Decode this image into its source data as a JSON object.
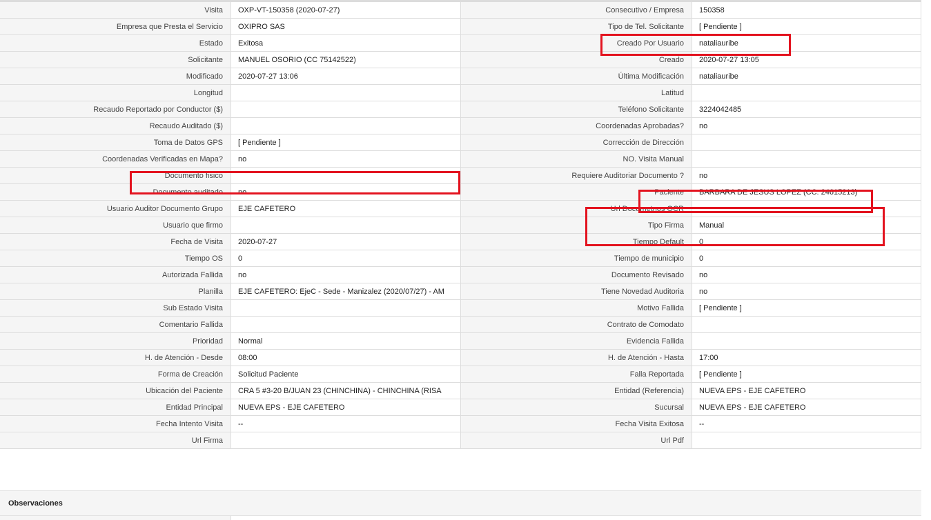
{
  "rows": [
    {
      "l1": "Visita",
      "v1": "OXP-VT-150358 (2020-07-27)",
      "l2": "Consecutivo / Empresa",
      "v2": "150358"
    },
    {
      "l1": "Empresa que Presta el Servicio",
      "v1": "OXIPRO SAS",
      "l2": "Tipo de Tel. Solicitante",
      "v2": "[ Pendiente ]"
    },
    {
      "l1": "Estado",
      "v1": "Exitosa",
      "l2": "Creado Por Usuario",
      "v2": "nataliauribe"
    },
    {
      "l1": "Solicitante",
      "v1": "MANUEL OSORIO (CC 75142522)",
      "l2": "Creado",
      "v2": "2020-07-27 13:05"
    },
    {
      "l1": "Modificado",
      "v1": "2020-07-27 13:06",
      "l2": "Última Modificación",
      "v2": " nataliauribe"
    },
    {
      "l1": "Longitud",
      "v1": "",
      "l2": "Latitud",
      "v2": ""
    },
    {
      "l1": "Recaudo Reportado por Conductor ($)",
      "v1": "",
      "l2": "Teléfono Solicitante",
      "v2": "3224042485"
    },
    {
      "l1": "Recaudo Auditado ($)",
      "v1": "",
      "l2": "Coordenadas Aprobadas?",
      "v2": " no"
    },
    {
      "l1": "Toma de Datos GPS",
      "v1": "[ Pendiente ]",
      "l2": "Corrección de Dirección",
      "v2": ""
    },
    {
      "l1": "Coordenadas Verificadas en Mapa?",
      "v1": " no",
      "l2": "NO. Visita Manual",
      "v2": ""
    },
    {
      "l1": "Documento fisico",
      "v1": "",
      "l2": "Requiere Auditoriar Documento ?",
      "v2": " no"
    },
    {
      "l1": "Documento auditado",
      "v1": " no",
      "l2": "Paciente",
      "v2": "BARBARA DE JESUS LOPEZ (CC: 24615213)"
    },
    {
      "l1": "Usuario Auditor Documento Grupo",
      "v1": "EJE CAFETERO",
      "l2": "Url Documetnos OCR",
      "v2": ""
    },
    {
      "l1": "Usuario que firmo",
      "v1": "",
      "l2": "Tipo Firma",
      "v2": "Manual"
    },
    {
      "l1": "Fecha de Visita",
      "v1": " 2020-07-27",
      "l2": "Tiempo Default",
      "v2": "0"
    },
    {
      "l1": "Tiempo OS",
      "v1": "0",
      "l2": "Tiempo de municipio",
      "v2": "0"
    },
    {
      "l1": "Autorizada Fallida",
      "v1": " no",
      "l2": "Documento Revisado",
      "v2": " no"
    },
    {
      "l1": "Planilla",
      "v1": "EJE CAFETERO: EjeC - Sede - Manizalez (2020/07/27) - AM",
      "l2": "Tiene Novedad Auditoria",
      "v2": " no"
    },
    {
      "l1": "Sub Estado Visita",
      "v1": "",
      "l2": "Motivo Fallida",
      "v2": "[ Pendiente ]"
    },
    {
      "l1": "Comentario Fallida",
      "v1": "",
      "l2": "Contrato de Comodato",
      "v2": ""
    },
    {
      "l1": "Prioridad",
      "v1": "Normal",
      "l2": "Evidencia Fallida",
      "v2": ""
    },
    {
      "l1": "H. de Atención - Desde",
      "v1": "08:00",
      "l2": "H. de Atención - Hasta",
      "v2": "17:00"
    },
    {
      "l1": "Forma de Creación",
      "v1": "Solicitud Paciente",
      "l2": "Falla Reportada",
      "v2": "[ Pendiente ]"
    },
    {
      "l1": "Ubicación del Paciente",
      "v1": "CRA 5 #3-20 B/JUAN 23 (CHINCHINA) - CHINCHINA (RISA",
      "l2": "Entidad (Referencia)",
      "v2": "NUEVA EPS - EJE CAFETERO"
    },
    {
      "l1": "Entidad Principal",
      "v1": "NUEVA EPS - EJE CAFETERO",
      "l2": "Sucursal",
      "v2": "NUEVA EPS - EJE CAFETERO"
    },
    {
      "l1": "Fecha Intento Visita",
      "v1": " --",
      "l2": "Fecha Visita Exitosa",
      "v2": " --"
    },
    {
      "l1": "Url Firma",
      "v1": "",
      "l2": "Url Pdf",
      "v2": ""
    }
  ],
  "observaciones_title": "Observaciones",
  "colors": {
    "highlight": "#e3131f",
    "label_bg": "#f5f5f5",
    "border": "#dddddd"
  }
}
